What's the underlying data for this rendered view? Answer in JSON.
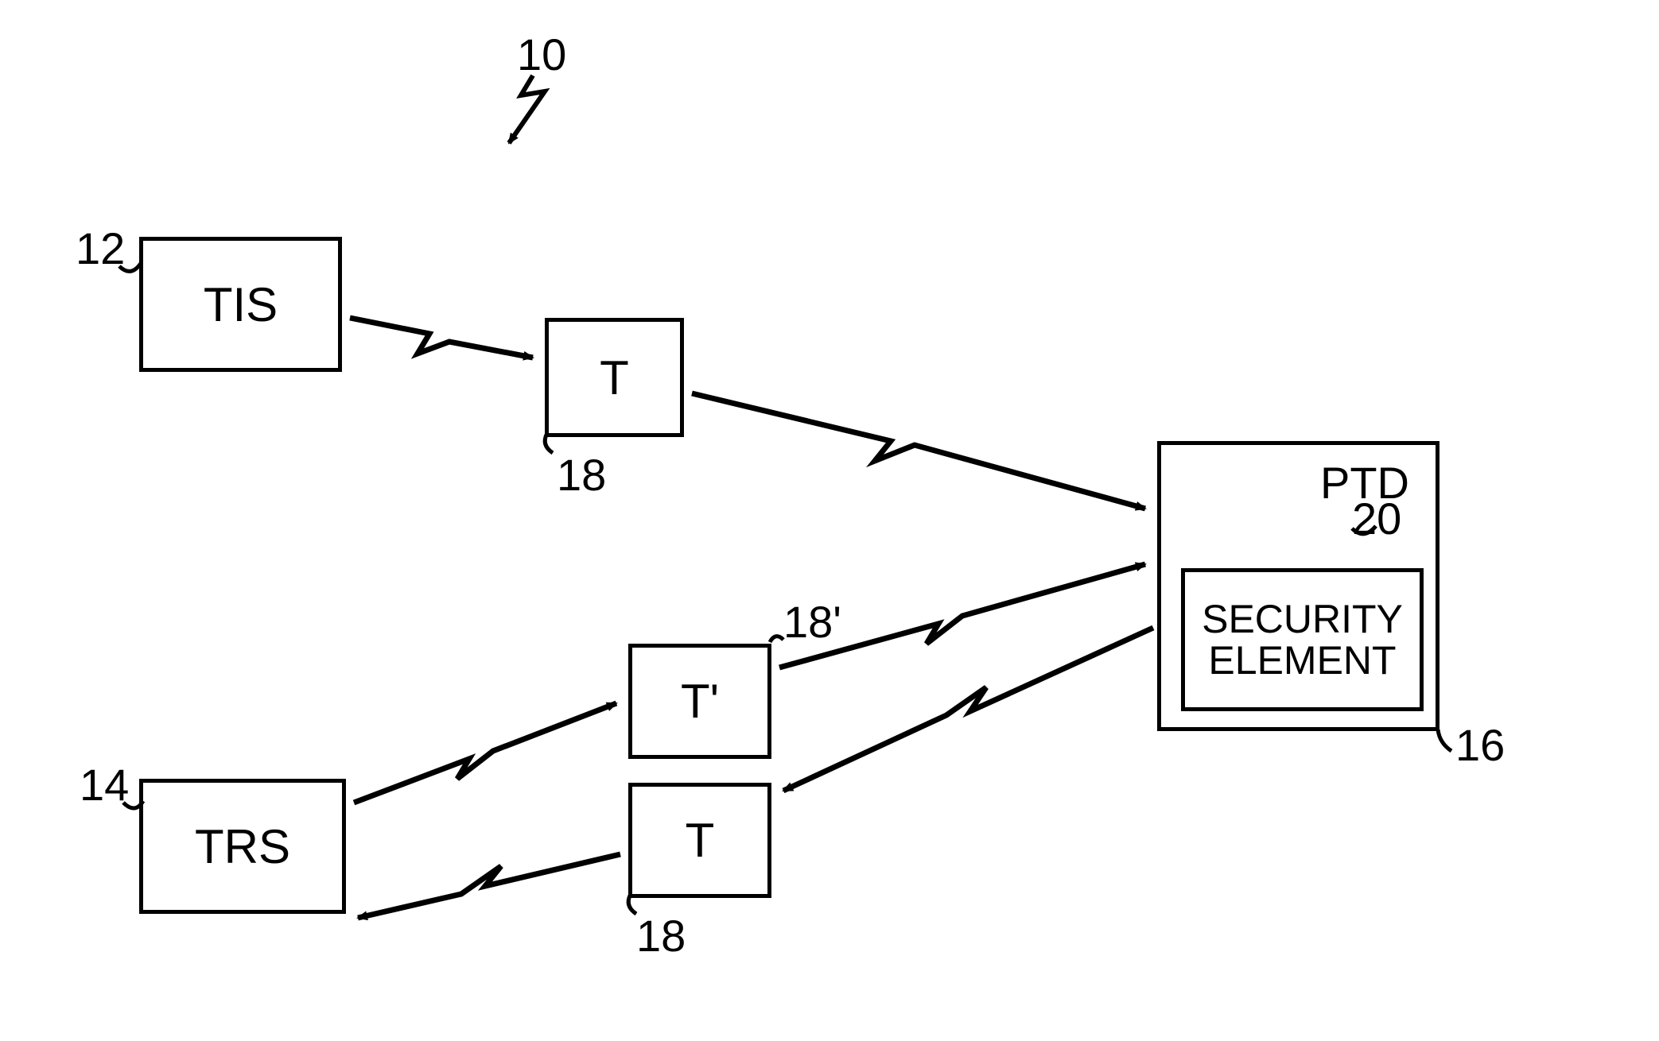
{
  "refs": {
    "diagram": "10",
    "tis": "12",
    "trs": "14",
    "ptd": "16",
    "t_top": "18",
    "t_bottom": "18",
    "t_prime": "18'",
    "security": "20"
  },
  "labels": {
    "tis": "TIS",
    "trs": "TRS",
    "t": "T",
    "t_prime": "T'",
    "ptd": "PTD",
    "security": "SECURITY\nELEMENT"
  }
}
